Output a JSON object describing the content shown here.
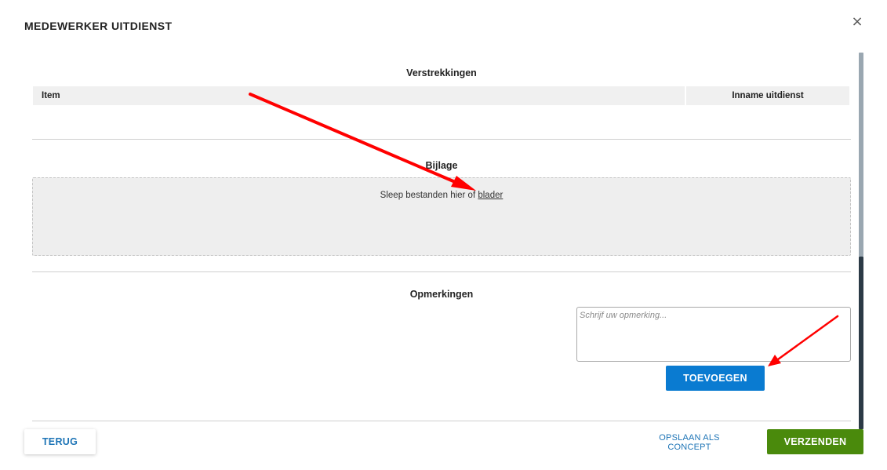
{
  "dialog": {
    "title": "MEDEWERKER UITDIENST",
    "close_icon": "×"
  },
  "verstrekkingen": {
    "title": "Verstrekkingen",
    "columns": [
      "Item",
      "Inname uitdienst"
    ]
  },
  "bijlage": {
    "title": "Bijlage",
    "drop_text": "Sleep bestanden hier of ",
    "browse_link": "blader"
  },
  "opmerkingen": {
    "title": "Opmerkingen",
    "placeholder": "Schrijf uw opmerking...",
    "add_label": "TOEVOEGEN"
  },
  "footer": {
    "back_label": "TERUG",
    "concept_label": "OPSLAAN ALS CONCEPT",
    "send_label": "VERZENDEN"
  },
  "colors": {
    "primary_blue": "#0a7bd1",
    "send_green": "#4a8a0c",
    "annotation_red": "#ff0000"
  }
}
